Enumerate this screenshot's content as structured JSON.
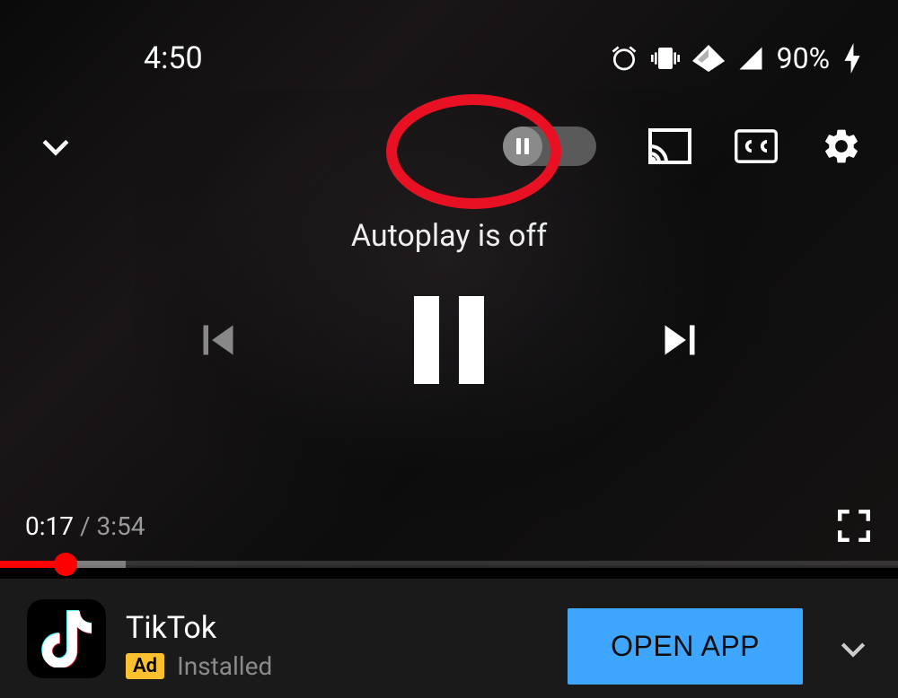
{
  "status": {
    "time": "4:50",
    "battery": "90%"
  },
  "player": {
    "autoplay_label": "Autoplay is off",
    "current_time": "0:17",
    "duration": "3:54",
    "separator": " / "
  },
  "ad": {
    "title": "TikTok",
    "badge": "Ad",
    "status": "Installed",
    "cta": "OPEN APP"
  }
}
